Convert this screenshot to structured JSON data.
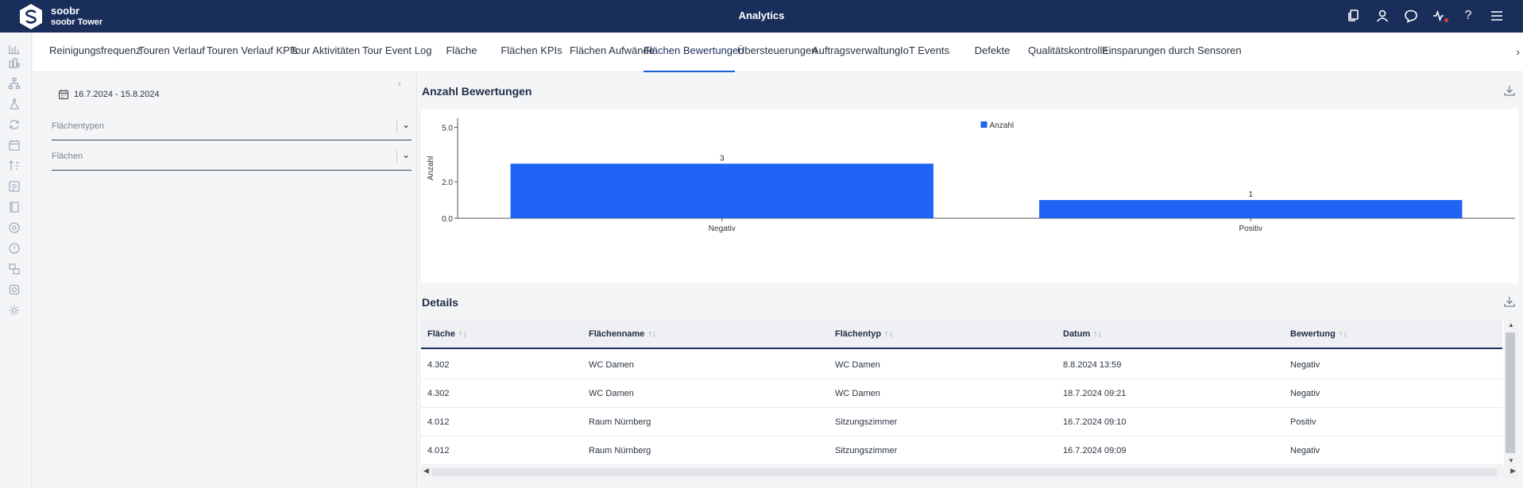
{
  "header": {
    "brand_name": "soobr",
    "brand_sub": "soobr Tower",
    "title": "Analytics",
    "icons": [
      "copy-icon",
      "user-icon",
      "chat-icon",
      "activity-icon",
      "help-icon",
      "menu-icon"
    ],
    "help_glyph": "?"
  },
  "rail": {
    "icons": [
      "bar-chart-icon",
      "building-chart-icon",
      "hierarchy-icon",
      "flask-icon",
      "refresh-icon",
      "calendar-cycle-icon",
      "sort-icon",
      "checklist-icon",
      "book-icon",
      "gauge-icon",
      "warning-icon",
      "devices-icon",
      "settings-cog-icon",
      "gear-icon"
    ]
  },
  "tabs": {
    "items": [
      {
        "label": "Reinigungsfrequenz"
      },
      {
        "label": "Touren Verlauf"
      },
      {
        "label": "Touren Verlauf KPIs"
      },
      {
        "label": "Tour Aktivitäten"
      },
      {
        "label": "Tour Event Log"
      },
      {
        "label": "Fläche"
      },
      {
        "label": "Flächen KPIs"
      },
      {
        "label": "Flächen Aufwände"
      },
      {
        "label": "Flächen Bewertungen"
      },
      {
        "label": "Übersteuerungen"
      },
      {
        "label": "Auftragsverwaltung"
      },
      {
        "label": "IoT Events"
      },
      {
        "label": "Defekte"
      },
      {
        "label": "Qualitätskontrolle"
      },
      {
        "label": "Einsparungen durch Sensoren"
      }
    ],
    "active": "Flächen Bewertungen",
    "next_glyph": "›"
  },
  "filters": {
    "collapse_glyph": "‹",
    "date_range": "16.7.2024 - 15.8.2024",
    "area_types_placeholder": "Flächentypen",
    "areas_placeholder": "Flächen",
    "chevron": "⌄"
  },
  "chart_section": {
    "title": "Anzahl Bewertungen"
  },
  "chart_data": {
    "type": "bar",
    "categories": [
      "Negativ",
      "Positiv"
    ],
    "series": [
      {
        "name": "Anzahl",
        "values": [
          3,
          1
        ],
        "color": "#1f64f4"
      }
    ],
    "data_labels": [
      "3",
      "1"
    ],
    "ylabel": "Anzahl",
    "yticks": [
      "5.0",
      "2.0",
      "0.0"
    ],
    "ylim": [
      0,
      5.5
    ],
    "legend": "top-center",
    "grid": false
  },
  "details": {
    "title": "Details",
    "columns": [
      "Fläche",
      "Flächenname",
      "Flächentyp",
      "Datum",
      "Bewertung"
    ],
    "sort_glyph": "↑↓",
    "rows": [
      [
        "4.302",
        "WC Damen",
        "WC Damen",
        "8.8.2024 13:59",
        "Negativ"
      ],
      [
        "4.302",
        "WC Damen",
        "WC Damen",
        "18.7.2024 09:21",
        "Negativ"
      ],
      [
        "4.012",
        "Raum Nürnberg",
        "Sitzungszimmer",
        "16.7.2024 09:10",
        "Positiv"
      ],
      [
        "4.012",
        "Raum Nürnberg",
        "Sitzungszimmer",
        "16.7.2024 09:09",
        "Negativ"
      ]
    ]
  }
}
